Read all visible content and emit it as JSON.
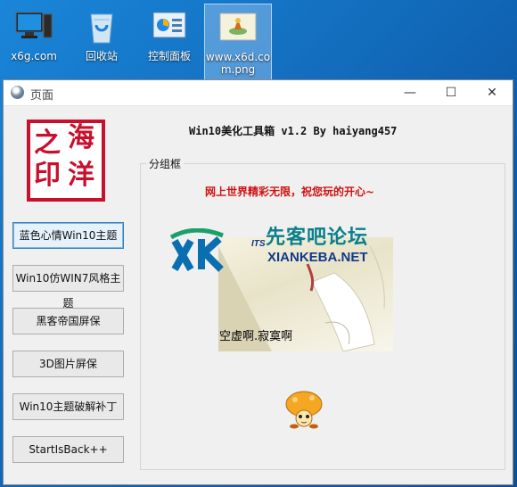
{
  "desktop": {
    "icons": [
      {
        "label": "x6g.com"
      },
      {
        "label": "回收站"
      },
      {
        "label": "控制面板"
      },
      {
        "label_line1": "www.x6d.co",
        "label_line2": "m.png"
      }
    ]
  },
  "window": {
    "title": "页面",
    "controls": {
      "minimize": "—",
      "maximize": "☐",
      "close": "✕"
    }
  },
  "seal": {
    "chars": [
      "之",
      "海",
      "印",
      "洋"
    ]
  },
  "app": {
    "header": "Win10美化工具箱 v1.2 By haiyang457"
  },
  "sidebar": {
    "buttons": [
      {
        "label": "蓝色心情Win10主题"
      },
      {
        "label": "Win10仿WIN7风格主题"
      },
      {
        "label": "黑客帝国屏保"
      },
      {
        "label": "3D图片屏保"
      },
      {
        "label": "Win10主题破解补丁"
      },
      {
        "label": "StartIsBack++"
      }
    ]
  },
  "group": {
    "legend": "分组框",
    "greeting": "网上世界精彩无限，祝您玩的开心~",
    "banner": {
      "brand_cn": "先客吧论坛",
      "brand_en": "XIANKEBA.NET",
      "its_badge": "ITS",
      "caption": "空虚啊.寂寞啊"
    }
  },
  "colors": {
    "seal_red": "#c8102e",
    "greeting_red": "#d01010",
    "brand_teal": "#0a7f8a"
  }
}
